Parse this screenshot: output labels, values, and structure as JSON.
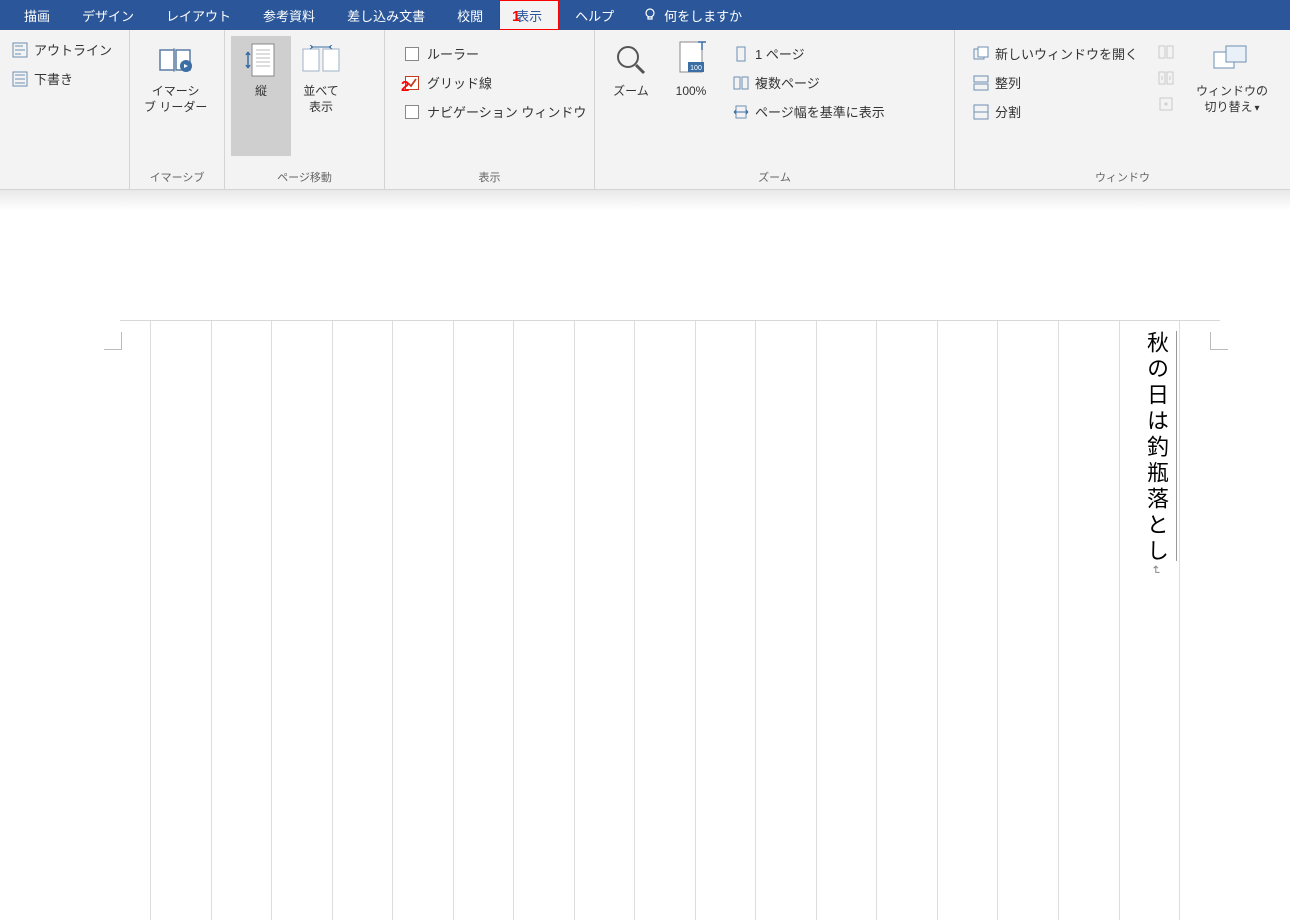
{
  "menu": {
    "tabs": [
      "描画",
      "デザイン",
      "レイアウト",
      "参考資料",
      "差し込み文書",
      "校閲",
      "表示",
      "ヘルプ"
    ],
    "active_index": 6,
    "tell_me": "何をしますか"
  },
  "annotations": {
    "one": "1",
    "two": "2"
  },
  "ribbon": {
    "views": {
      "outline": "アウトライン",
      "draft": "下書き"
    },
    "immersive": {
      "reader": "イマーシ\nブ リーダー",
      "group": "イマーシブ"
    },
    "page_move": {
      "vertical": "縦",
      "side": "並べて\n表示",
      "group": "ページ移動"
    },
    "show": {
      "ruler": "ルーラー",
      "grid": "グリッド線",
      "nav": "ナビゲーション ウィンドウ",
      "group": "表示"
    },
    "zoom": {
      "zoom": "ズーム",
      "hundred": "100%",
      "one_page": "1 ページ",
      "multi_page": "複数ページ",
      "page_width": "ページ幅を基準に表示",
      "group": "ズーム"
    },
    "window": {
      "new_win": "新しいウィンドウを開く",
      "arrange": "整列",
      "split": "分割",
      "switch": "ウィンドウの\n切り替え",
      "group": "ウィンドウ"
    }
  },
  "document": {
    "text": "秋の日は釣瓶落とし"
  }
}
